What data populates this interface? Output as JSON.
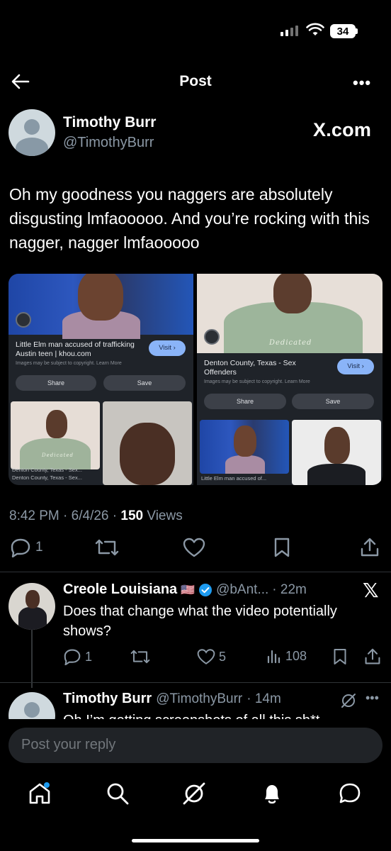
{
  "status_bar": {
    "battery": "34"
  },
  "header": {
    "title": "Post"
  },
  "post": {
    "author_name": "Timothy Burr",
    "author_handle": "@TimothyBurr",
    "badge": "X.com",
    "text": "Oh my goodness you naggers are absolutely disgusting lmfaooooo. And you’re rocking with this nagger, nagger lmfaooooo",
    "time": "8:42 PM",
    "date": "6/4/26",
    "views_count": "150",
    "views_label": "Views",
    "reply_count": "1"
  },
  "media": {
    "left_card": {
      "title": "Little Elm man accused of trafficking Austin teen | khou.com",
      "note": "Images may be subject to copyright. Learn More",
      "visit": "Visit ›",
      "share": "Share",
      "save": "Save",
      "thumb1_cap1": "Denton County, Texas - Sex...",
      "thumb1_cap2": "Denton County, Texas - Sex...",
      "shirt_text": "Dedicated"
    },
    "right_card": {
      "title": "Denton County, Texas - Sex Offenders",
      "note": "Images may be subject to copyright. Learn More",
      "visit": "Visit ›",
      "share": "Share",
      "save": "Save",
      "thumb_cap": "Little Elm man accused of...",
      "shirt_text": "Dedicated"
    }
  },
  "replies": [
    {
      "name": "Creole Louisiana",
      "flag": "🇺🇸",
      "handle": "@bAnt...",
      "time": "· 22m",
      "text": "Does that change what the video potentially shows?",
      "reply_count": "1",
      "like_count": "5",
      "view_count": "108"
    },
    {
      "name": "Timothy Burr",
      "handle": "@TimothyBurr",
      "time": "· 14m",
      "text": "Oh I’m getting screenshots of all this sh*t"
    }
  ],
  "composer": {
    "placeholder": "Post your reply"
  },
  "colors": {
    "background": "#000000",
    "text": "#e7e9ea",
    "muted": "#8b98a5",
    "verified": "#1d9bf0",
    "accent": "#1d9bf0"
  },
  "icons": [
    "back-arrow-icon",
    "more-icon",
    "reply-icon",
    "retweet-icon",
    "like-icon",
    "bookmark-icon",
    "share-icon",
    "home-icon",
    "search-icon",
    "grok-icon",
    "notifications-icon",
    "messages-icon"
  ]
}
